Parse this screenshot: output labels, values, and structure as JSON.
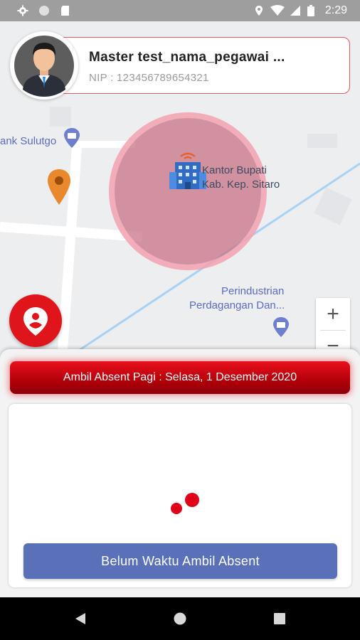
{
  "status_bar": {
    "time": "2:29",
    "left_icons": [
      "gear-icon",
      "circle-icon",
      "sd-card-icon"
    ],
    "right_icons": [
      "location-icon",
      "wifi-icon",
      "signal-icon",
      "battery-icon"
    ]
  },
  "profile": {
    "name": "Master test_nama_pegawai ...",
    "nip": "NIP : 123456789654321"
  },
  "map": {
    "labels": {
      "bank": "ank Sulutgo",
      "office_line1": "Kantor Bupati",
      "office_line2": "Kab. Kep. Sitaro",
      "ministry_line1": "Perindustrian",
      "ministry_line2": "Perdagangan Dan..."
    },
    "zoom_in": "+",
    "zoom_out": "−",
    "colors": {
      "geofence": "#c86e82",
      "pin": "#e8892d",
      "poi": "#5c6bc0"
    }
  },
  "attendance": {
    "banner": "Ambil Absent Pagi : Selasa, 1 Desember 2020",
    "button": "Belum Waktu Ambil Absent",
    "colors": {
      "banner": "#c8000d",
      "button": "#5a71ba"
    }
  },
  "nav": {
    "icons": [
      "back-icon",
      "home-icon",
      "recents-icon"
    ]
  }
}
